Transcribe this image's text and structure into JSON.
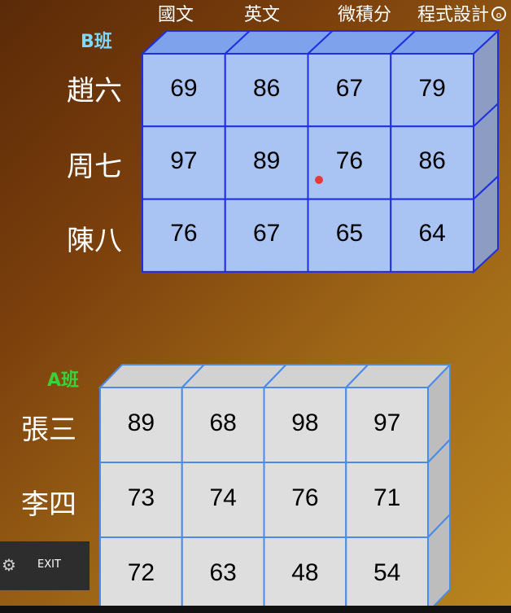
{
  "columns": [
    "國文",
    "英文",
    "微積分",
    "程式設計"
  ],
  "class_b": {
    "label": "B班",
    "label_color": "#7fd8ff",
    "face_color": "#a9c3f3",
    "top_color": "#7ea3ec",
    "side_color": "#8d9cc3",
    "border_color": "#1f2fe0",
    "rows": [
      {
        "name": "趙六",
        "scores": [
          "69",
          "86",
          "67",
          "79"
        ]
      },
      {
        "name": "周七",
        "scores": [
          "97",
          "89",
          "76",
          "86"
        ]
      },
      {
        "name": "陳八",
        "scores": [
          "76",
          "67",
          "65",
          "64"
        ]
      }
    ]
  },
  "class_a": {
    "label": "A班",
    "label_color": "#3ad23a",
    "face_color": "#dedede",
    "top_color": "#d2d2d2",
    "side_color": "#bdbdbd",
    "border_color": "#4a8ae8",
    "rows": [
      {
        "name": "張三",
        "scores": [
          "89",
          "68",
          "98",
          "97"
        ]
      },
      {
        "name": "李四",
        "scores": [
          "73",
          "74",
          "76",
          "71"
        ]
      },
      {
        "name": "",
        "scores": [
          "72",
          "63",
          "48",
          "54"
        ]
      }
    ]
  },
  "controls": {
    "exit_label": "EXIT",
    "settings_icon": "gear-icon"
  }
}
